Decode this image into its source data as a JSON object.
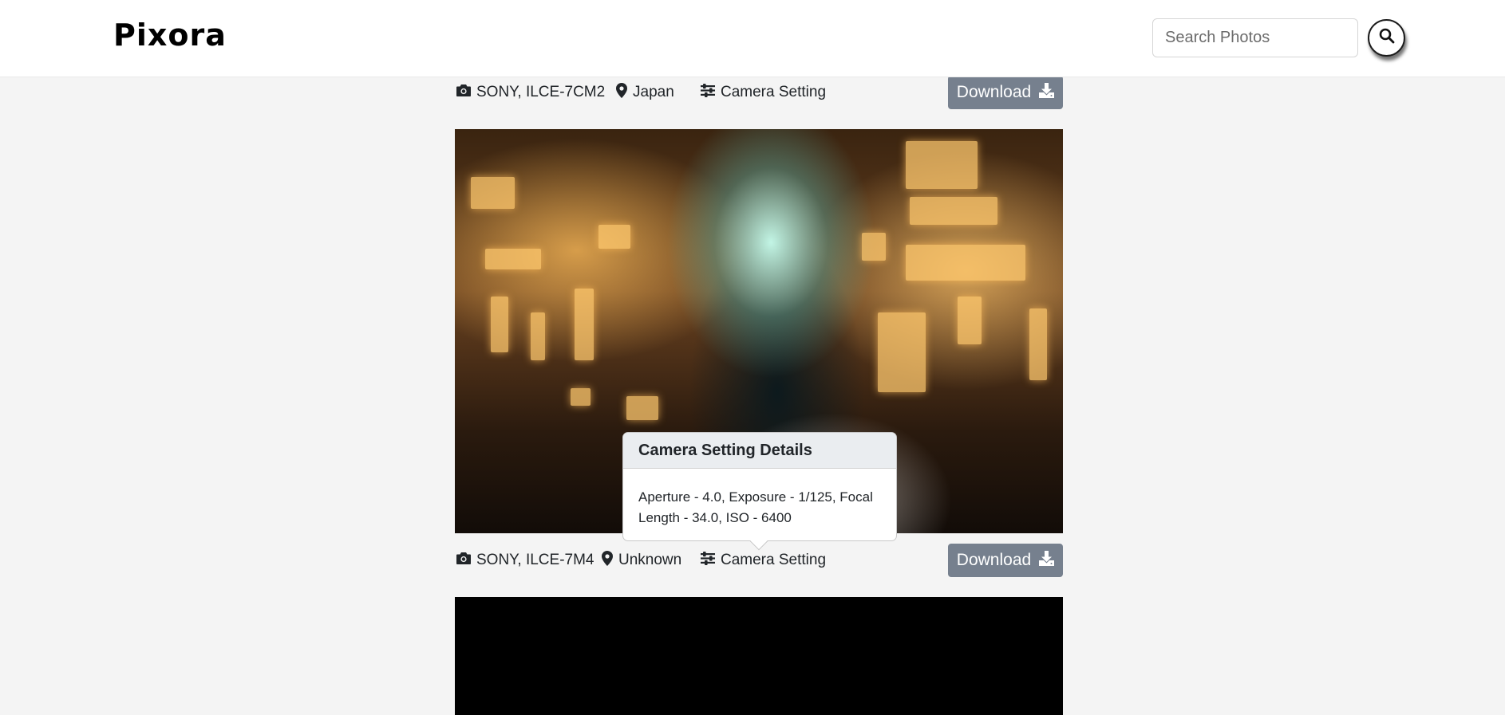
{
  "header": {
    "logo": "Pixora",
    "search": {
      "placeholder": "Search Photos",
      "value": ""
    },
    "search_button_icon": "search-icon"
  },
  "posts": [
    {
      "camera": "SONY, ILCE-7CM2",
      "location": "Japan",
      "settings_label": "Camera Setting",
      "download_label": "Download"
    },
    {
      "camera": "SONY, ILCE-7M4",
      "location": "Unknown",
      "settings_label": "Camera Setting",
      "download_label": "Download"
    }
  ],
  "popover": {
    "title": "Camera Setting Details",
    "body": "Aperture - 4.0, Exposure - 1/125, Focal Length - 34.0, ISO - 6400"
  },
  "colors": {
    "download_button": "#76808e",
    "background": "#f4f4f4",
    "popover_header": "#eaedf0"
  }
}
